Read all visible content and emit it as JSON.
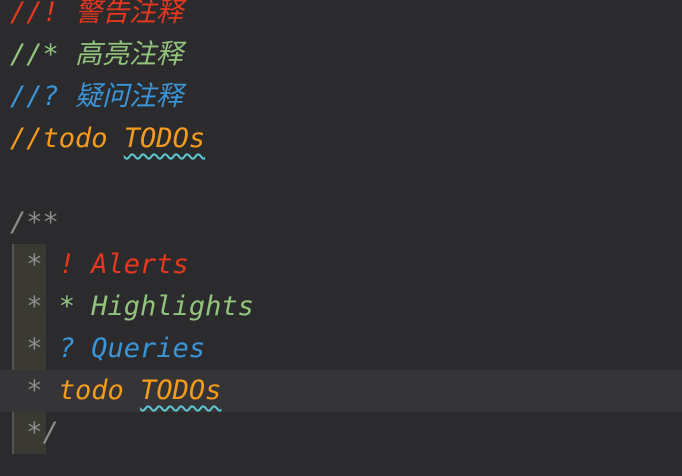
{
  "editor": {
    "lines": [
      {
        "tokens": [
          {
            "text": "//! 警告注释",
            "color": "#e5381f"
          }
        ]
      },
      {
        "tokens": [
          {
            "text": "//* 高亮注释",
            "color": "#93c47d"
          }
        ]
      },
      {
        "tokens": [
          {
            "text": "//? 疑问注释",
            "color": "#3a95d8"
          }
        ]
      },
      {
        "tokens": [
          {
            "text": "//todo ",
            "color": "#f59b1c"
          },
          {
            "text": "TODOs",
            "color": "#f59b1c",
            "squiggle": true
          }
        ]
      },
      {
        "tokens": []
      },
      {
        "tokens": [
          {
            "text": "/**",
            "color": "#8b8b8b"
          }
        ]
      },
      {
        "tokens": [
          {
            "text": " *",
            "color": "#8b8b8b"
          },
          {
            "text": " ! Alerts",
            "color": "#e5381f"
          }
        ]
      },
      {
        "tokens": [
          {
            "text": " *",
            "color": "#8b8b8b"
          },
          {
            "text": " * Highlights",
            "color": "#93c47d"
          }
        ]
      },
      {
        "tokens": [
          {
            "text": " *",
            "color": "#8b8b8b"
          },
          {
            "text": " ? Queries",
            "color": "#3a95d8"
          }
        ]
      },
      {
        "tokens": [
          {
            "text": " *",
            "color": "#8b8b8b"
          },
          {
            "text": " todo ",
            "color": "#f59b1c"
          },
          {
            "text": "TODOs",
            "color": "#f59b1c",
            "squiggle": true
          }
        ],
        "current": true
      },
      {
        "tokens": [
          {
            "text": " */",
            "color": "#8b8b8b"
          }
        ]
      }
    ],
    "colors": {
      "background": "#2b2b2d",
      "current_line": "#353538",
      "spell_squiggle": "#5fc7d3"
    }
  }
}
